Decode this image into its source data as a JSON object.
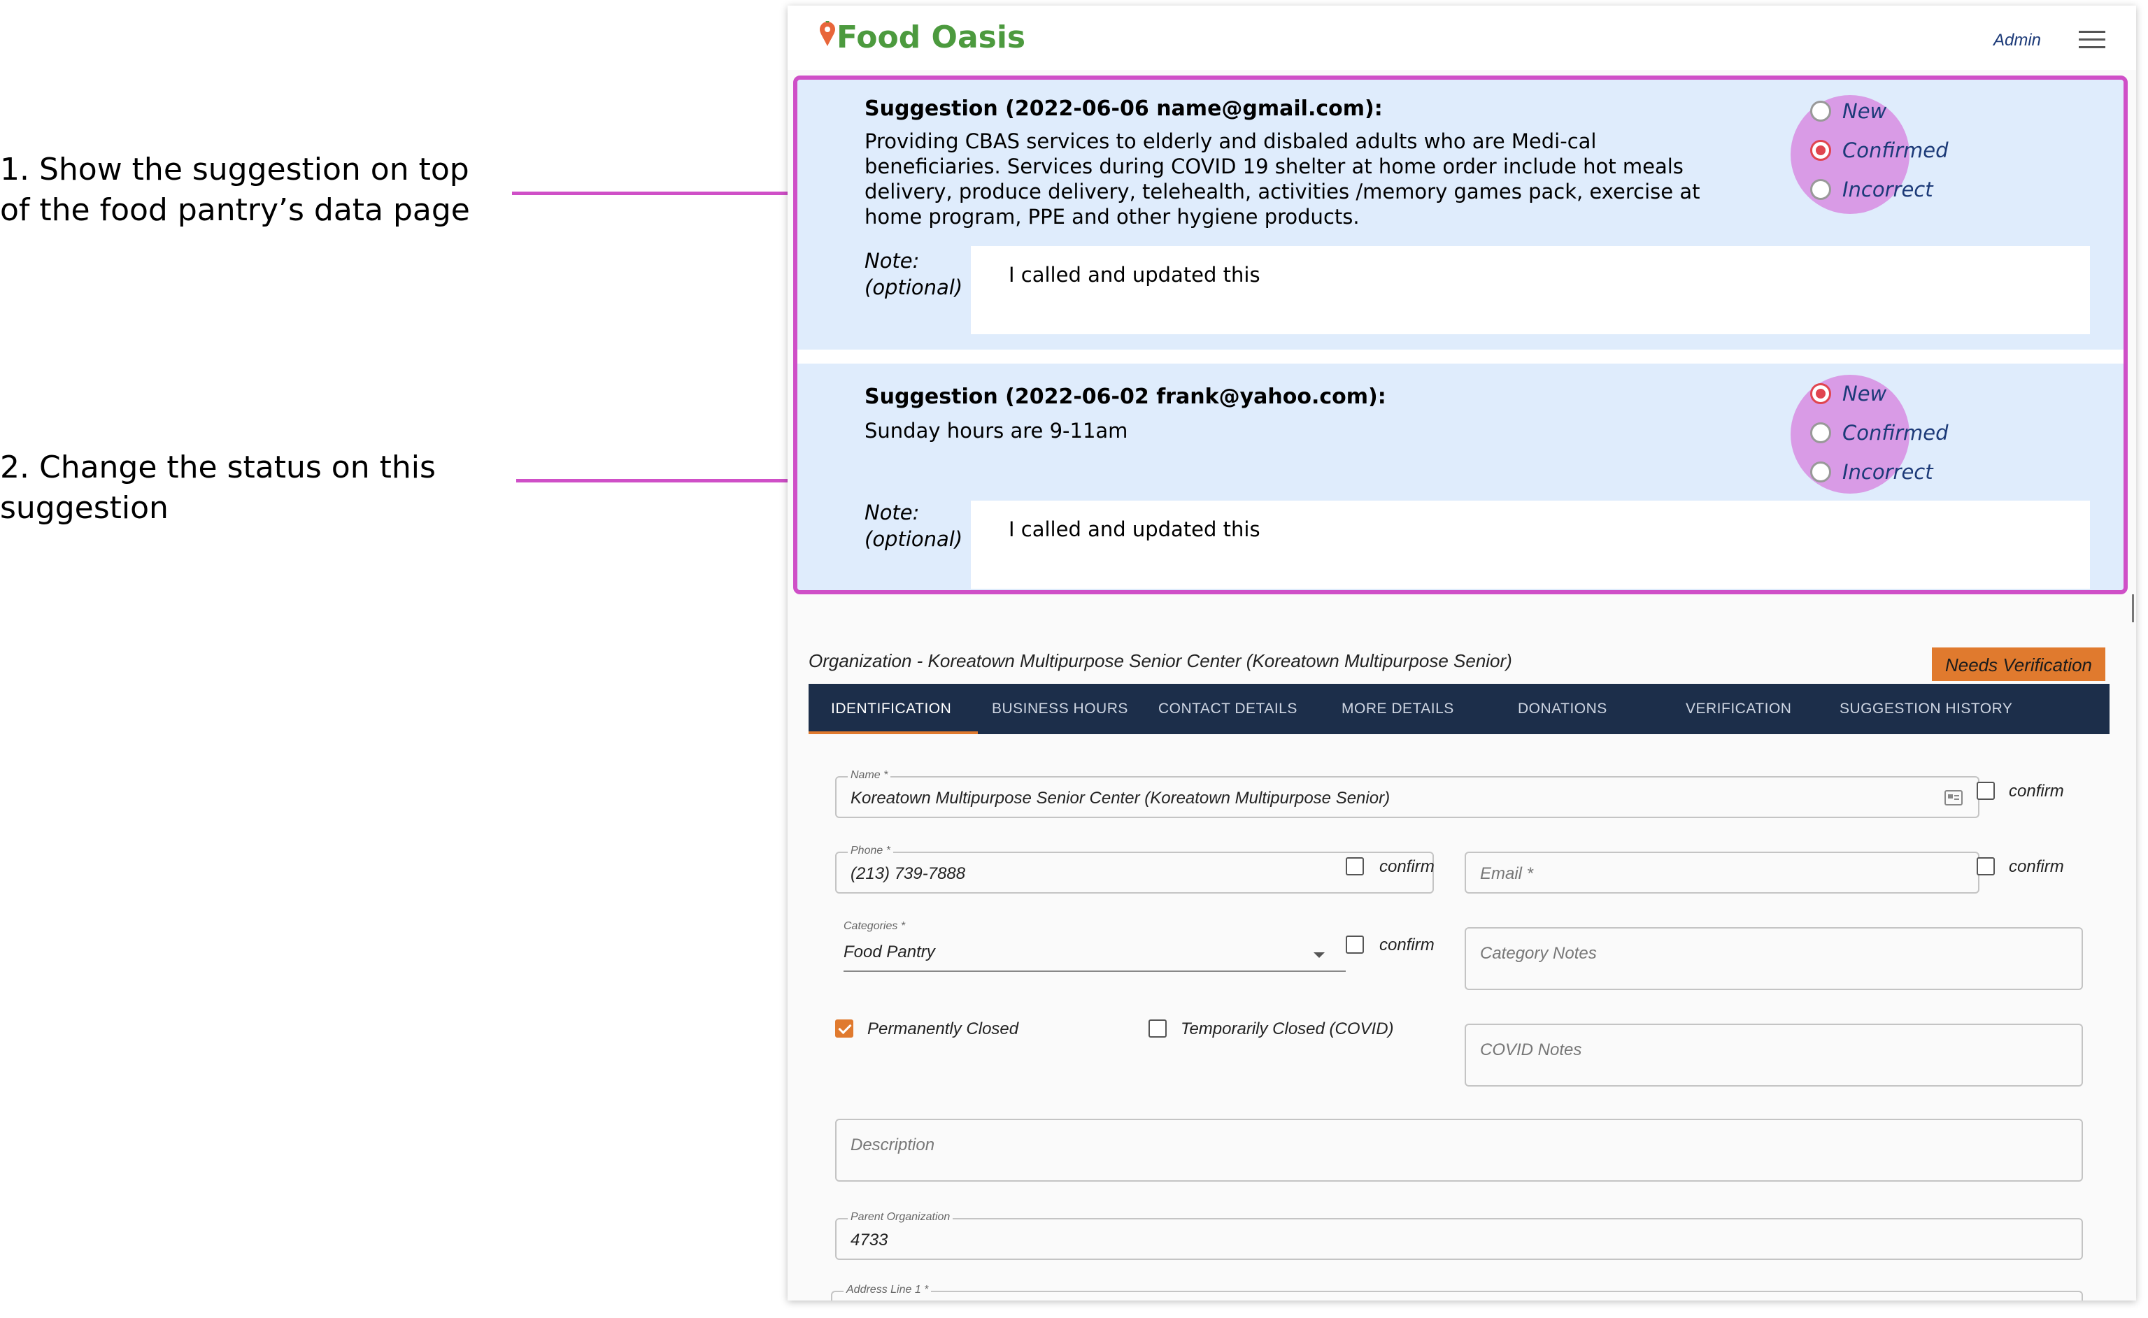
{
  "annotations": {
    "step1": " 1. Show the suggestion on top\nof the food pantry’s data page",
    "step2": "2. Change the status on this\nsuggestion"
  },
  "app": {
    "logo_text": "Food Oasis",
    "admin_label": "Admin",
    "menu_icon": "hamburger-menu-icon"
  },
  "suggestions": [
    {
      "title": "Suggestion (2022-06-06 name@gmail.com):",
      "body": "Providing CBAS services to elderly and disbaled adults who are Medi-cal beneficiaries. Services during COVID 19 shelter at home order include hot meals delivery, produce delivery, telehealth, activities /memory games pack, exercise at home program, PPE and other hygiene products.",
      "note_label": "Note:\n(optional)",
      "note_value": "I called and updated this",
      "status_options": [
        "New",
        "Confirmed",
        "Incorrect"
      ],
      "selected_status": "Confirmed"
    },
    {
      "title": "Suggestion (2022-06-02 frank@yahoo.com):",
      "body": "Sunday hours are 9-11am",
      "note_label": "Note:\n(optional)",
      "note_value": "I called and updated this",
      "status_options": [
        "New",
        "Confirmed",
        "Incorrect"
      ],
      "selected_status": "New"
    }
  ],
  "organization": {
    "title": "Organization - Koreatown Multipurpose Senior Center (Koreatown Multipurpose Senior)",
    "badge": "Needs Verification",
    "tabs": [
      "IDENTIFICATION",
      "BUSINESS HOURS",
      "CONTACT DETAILS",
      "MORE DETAILS",
      "DONATIONS",
      "VERIFICATION",
      "SUGGESTION HISTORY"
    ],
    "active_tab": "IDENTIFICATION",
    "confirm_label": "confirm",
    "name": {
      "label": "Name *",
      "value": "Koreatown Multipurpose Senior Center (Koreatown Multipurpose Senior)"
    },
    "phone": {
      "label": "Phone *",
      "value": "(213) 739-7888"
    },
    "email": {
      "placeholder": "Email *"
    },
    "categories": {
      "label": "Categories *",
      "value": "Food Pantry"
    },
    "category_notes": {
      "placeholder": "Category Notes"
    },
    "permanently_closed": {
      "label": "Permanently Closed",
      "checked": true
    },
    "temporarily_closed": {
      "label": "Temporarily Closed (COVID)",
      "checked": false
    },
    "covid_notes": {
      "placeholder": "COVID Notes"
    },
    "description": {
      "placeholder": "Description"
    },
    "parent_org": {
      "label": "Parent Organization",
      "value": "4733"
    },
    "address1": {
      "label": "Address Line 1 *"
    }
  },
  "colors": {
    "highlight": "#cf4fc7",
    "card_bg": "#dfecfc",
    "radio_selected": "#e0454f",
    "accent_orange": "#e07a2e",
    "tabs_bg": "#1c2e4a",
    "logo_green": "#4c9a3e"
  }
}
